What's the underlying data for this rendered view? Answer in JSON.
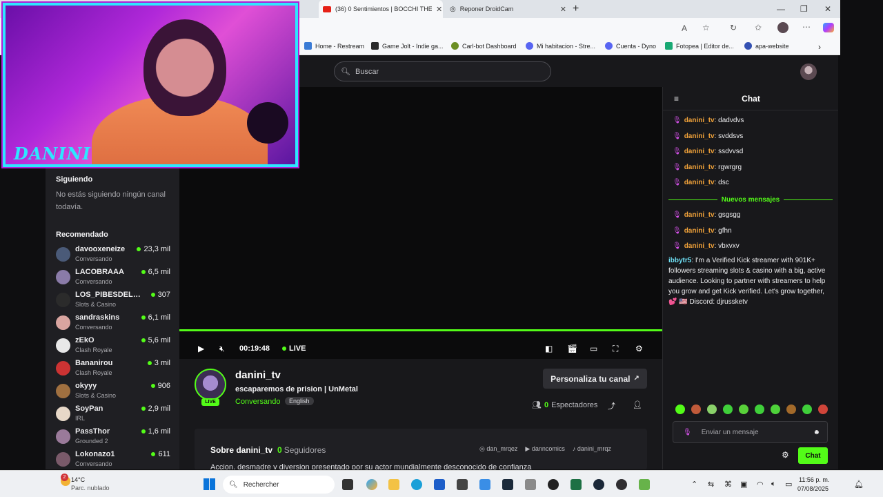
{
  "browser": {
    "tabs": [
      {
        "title": "(36) 0 Sentimientos | BOCCHI THE",
        "active": true
      },
      {
        "title": "Reponer DroidCam",
        "active": false
      }
    ],
    "new_tab": "+",
    "bookmarks": [
      {
        "label": "Home - Restream",
        "color": "#3a7bd5"
      },
      {
        "label": "Game Jolt - Indie ga...",
        "color": "#2b2b2b"
      },
      {
        "label": "Carl-bot Dashboard",
        "color": "#6b8e23"
      },
      {
        "label": "Mi habitacion - Stre...",
        "color": "#5865f2"
      },
      {
        "label": "Cuenta - Dyno",
        "color": "#5865f2"
      },
      {
        "label": "Fotopea | Editor de...",
        "color": "#19a974"
      },
      {
        "label": "apa-website",
        "color": "#3451b2"
      }
    ]
  },
  "search": {
    "placeholder": "Buscar"
  },
  "sidebar": {
    "following_title": "Siguiendo",
    "following_empty": "No estás siguiendo ningún canal todavía.",
    "recommended_title": "Recomendado",
    "channels": [
      {
        "name": "davooxeneize",
        "category": "Conversando",
        "viewers": "23,3 mil",
        "color": "#4a5a78"
      },
      {
        "name": "LACOBRAAA",
        "category": "Conversando",
        "viewers": "6,5 mil",
        "color": "#8a7ba8"
      },
      {
        "name": "LOS_PIBESDELPE...",
        "category": "Slots & Casino",
        "viewers": "307",
        "color": "#2b2b2b"
      },
      {
        "name": "sandraskins",
        "category": "Conversando",
        "viewers": "6,1 mil",
        "color": "#d9a5a0"
      },
      {
        "name": "zEkO",
        "category": "Clash Royale",
        "viewers": "5,6 mil",
        "color": "#e8e8e8"
      },
      {
        "name": "Bananirou",
        "category": "Clash Royale",
        "viewers": "3 mil",
        "color": "#c33"
      },
      {
        "name": "okyyy",
        "category": "Slots & Casino",
        "viewers": "906",
        "color": "#a07040"
      },
      {
        "name": "SoyPan",
        "category": "IRL",
        "viewers": "2,9 mil",
        "color": "#e7d8c8"
      },
      {
        "name": "PassThor",
        "category": "Grounded 2",
        "viewers": "1,6 mil",
        "color": "#9a7a9a"
      },
      {
        "name": "Lokonazo1",
        "category": "Conversando",
        "viewers": "611",
        "color": "#7a5a6a"
      }
    ]
  },
  "player": {
    "time": "00:19:48",
    "live_label": "LIVE"
  },
  "channel": {
    "name": "danini_tv",
    "title": "escaparemos de prision | UnMetal",
    "category": "Conversando",
    "language": "English",
    "live_badge": "LIVE",
    "customize_button": "Personaliza tu canal",
    "viewers_count": "0",
    "viewers_label": "Espectadores"
  },
  "about": {
    "title": "Sobre danini_tv",
    "followers_count": "0",
    "followers_label": "Seguidores",
    "socials": [
      "dan_mrqez",
      "danncomics",
      "danini_mrqz"
    ],
    "description": "Accion, desmadre y diversion presentado por su actor mundialmente desconocido de confianza"
  },
  "chat": {
    "title": "Chat",
    "messages_before": [
      {
        "user": "danini_tv",
        "text": "dadvdvs"
      },
      {
        "user": "danini_tv",
        "text": "svddsvs"
      },
      {
        "user": "danini_tv",
        "text": "ssdvvsd"
      },
      {
        "user": "danini_tv",
        "text": "rgwrgrg"
      },
      {
        "user": "danini_tv",
        "text": "dsc"
      }
    ],
    "new_messages_label": "Nuevos mensajes",
    "messages_after": [
      {
        "user": "danini_tv",
        "text": "gsgsgg"
      },
      {
        "user": "danini_tv",
        "text": "gfhn"
      },
      {
        "user": "danini_tv",
        "text": "vbxvxv"
      }
    ],
    "spam": {
      "user": "ibbytr5",
      "text": "I'm a Verified Kick streamer with 901K+ followers streaming slots & casino with a big, active audience. Looking to partner with streamers to help you grow and get Kick verified. Let's grow together, 💕 🇺🇸 Discord: djrussketv"
    },
    "input_placeholder": "Enviar un mensaje",
    "send_button": "Chat"
  },
  "webcam": {
    "overlay_text": "DANINI"
  },
  "taskbar": {
    "weather_temp": "14°C",
    "weather_desc": "Parc. nublado",
    "notification_count": "2",
    "search_placeholder": "Rechercher",
    "time": "11:56 p. m.",
    "date": "07/08/2025"
  }
}
